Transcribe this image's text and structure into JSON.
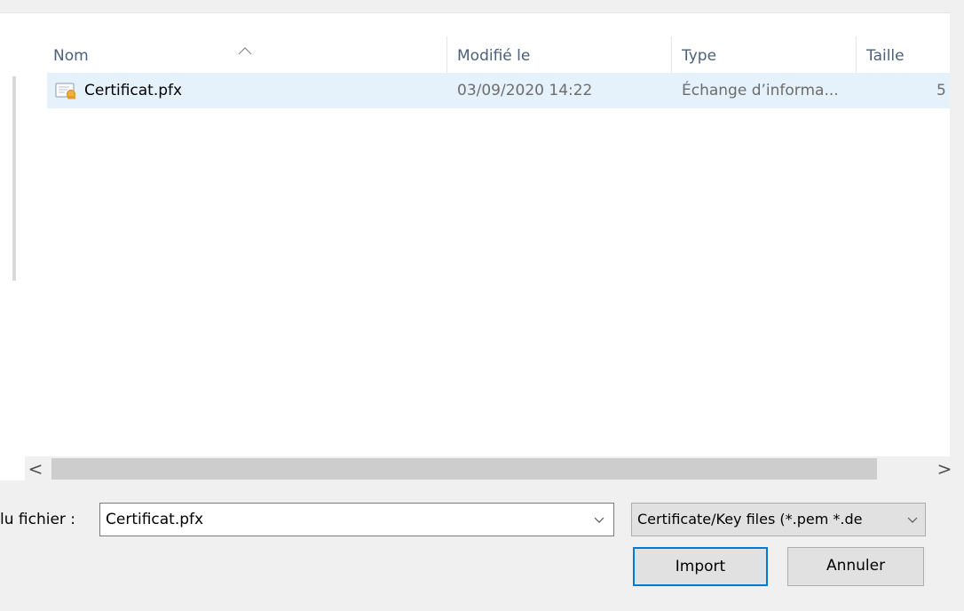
{
  "columns": {
    "name": "Nom",
    "modified": "Modifié le",
    "type": "Type",
    "size": "Taille"
  },
  "files": [
    {
      "name": "Certificat.pfx",
      "modified": "03/09/2020 14:22",
      "type": "Échange d’informa...",
      "size": "5",
      "icon": "certificate-icon"
    }
  ],
  "scrollbar": {
    "left_arrow": "<",
    "right_arrow": ">"
  },
  "filename": {
    "label": "lu fichier :",
    "value": "Certificat.pfx"
  },
  "filetype": {
    "value": "Certificate/Key files (*.pem *.de"
  },
  "buttons": {
    "import": "Import",
    "cancel": "Annuler"
  },
  "colors": {
    "selection": "#e5f1fb",
    "accent": "#0078d7",
    "header_text": "#4c607a"
  }
}
